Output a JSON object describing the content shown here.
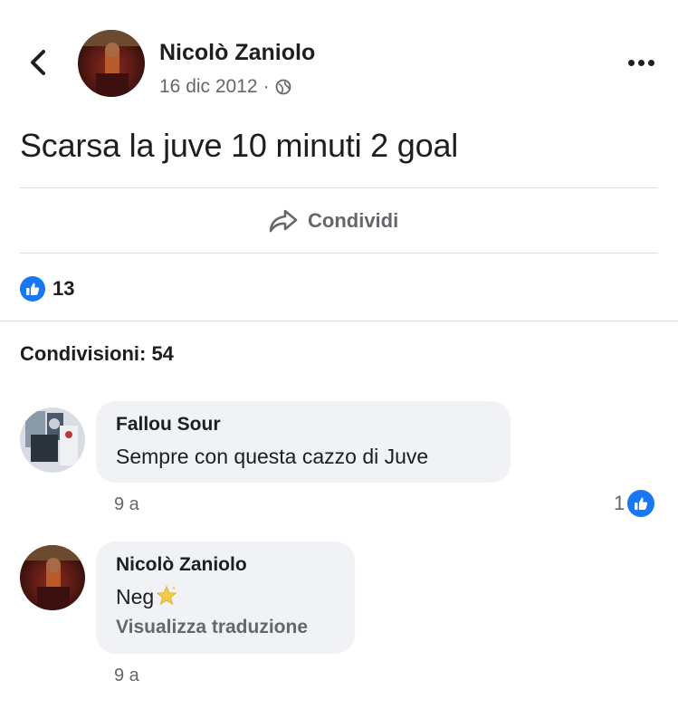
{
  "post": {
    "author": "Nicolò Zaniolo",
    "date": "16 dic 2012",
    "separator": "·",
    "privacy_icon": "globe-icon",
    "text": "Scarsa la juve 10 minuti 2 goal",
    "share_label": "Condividi",
    "likes_count": "13",
    "shares_label": "Condivisioni: 54"
  },
  "comments": [
    {
      "author": "Fallou Sour",
      "text": "Sempre con questa cazzo di Juve",
      "time": "9 a",
      "reactions": "1"
    },
    {
      "author": "Nicolò Zaniolo",
      "text": "Neg",
      "emoji_icon": "star-emoji-icon",
      "translate_label": "Visualizza traduzione",
      "time": "9 a"
    }
  ],
  "colors": {
    "facebook_blue": "#1877f2",
    "secondary_text": "#65676b",
    "bubble_bg": "#f0f2f5"
  }
}
